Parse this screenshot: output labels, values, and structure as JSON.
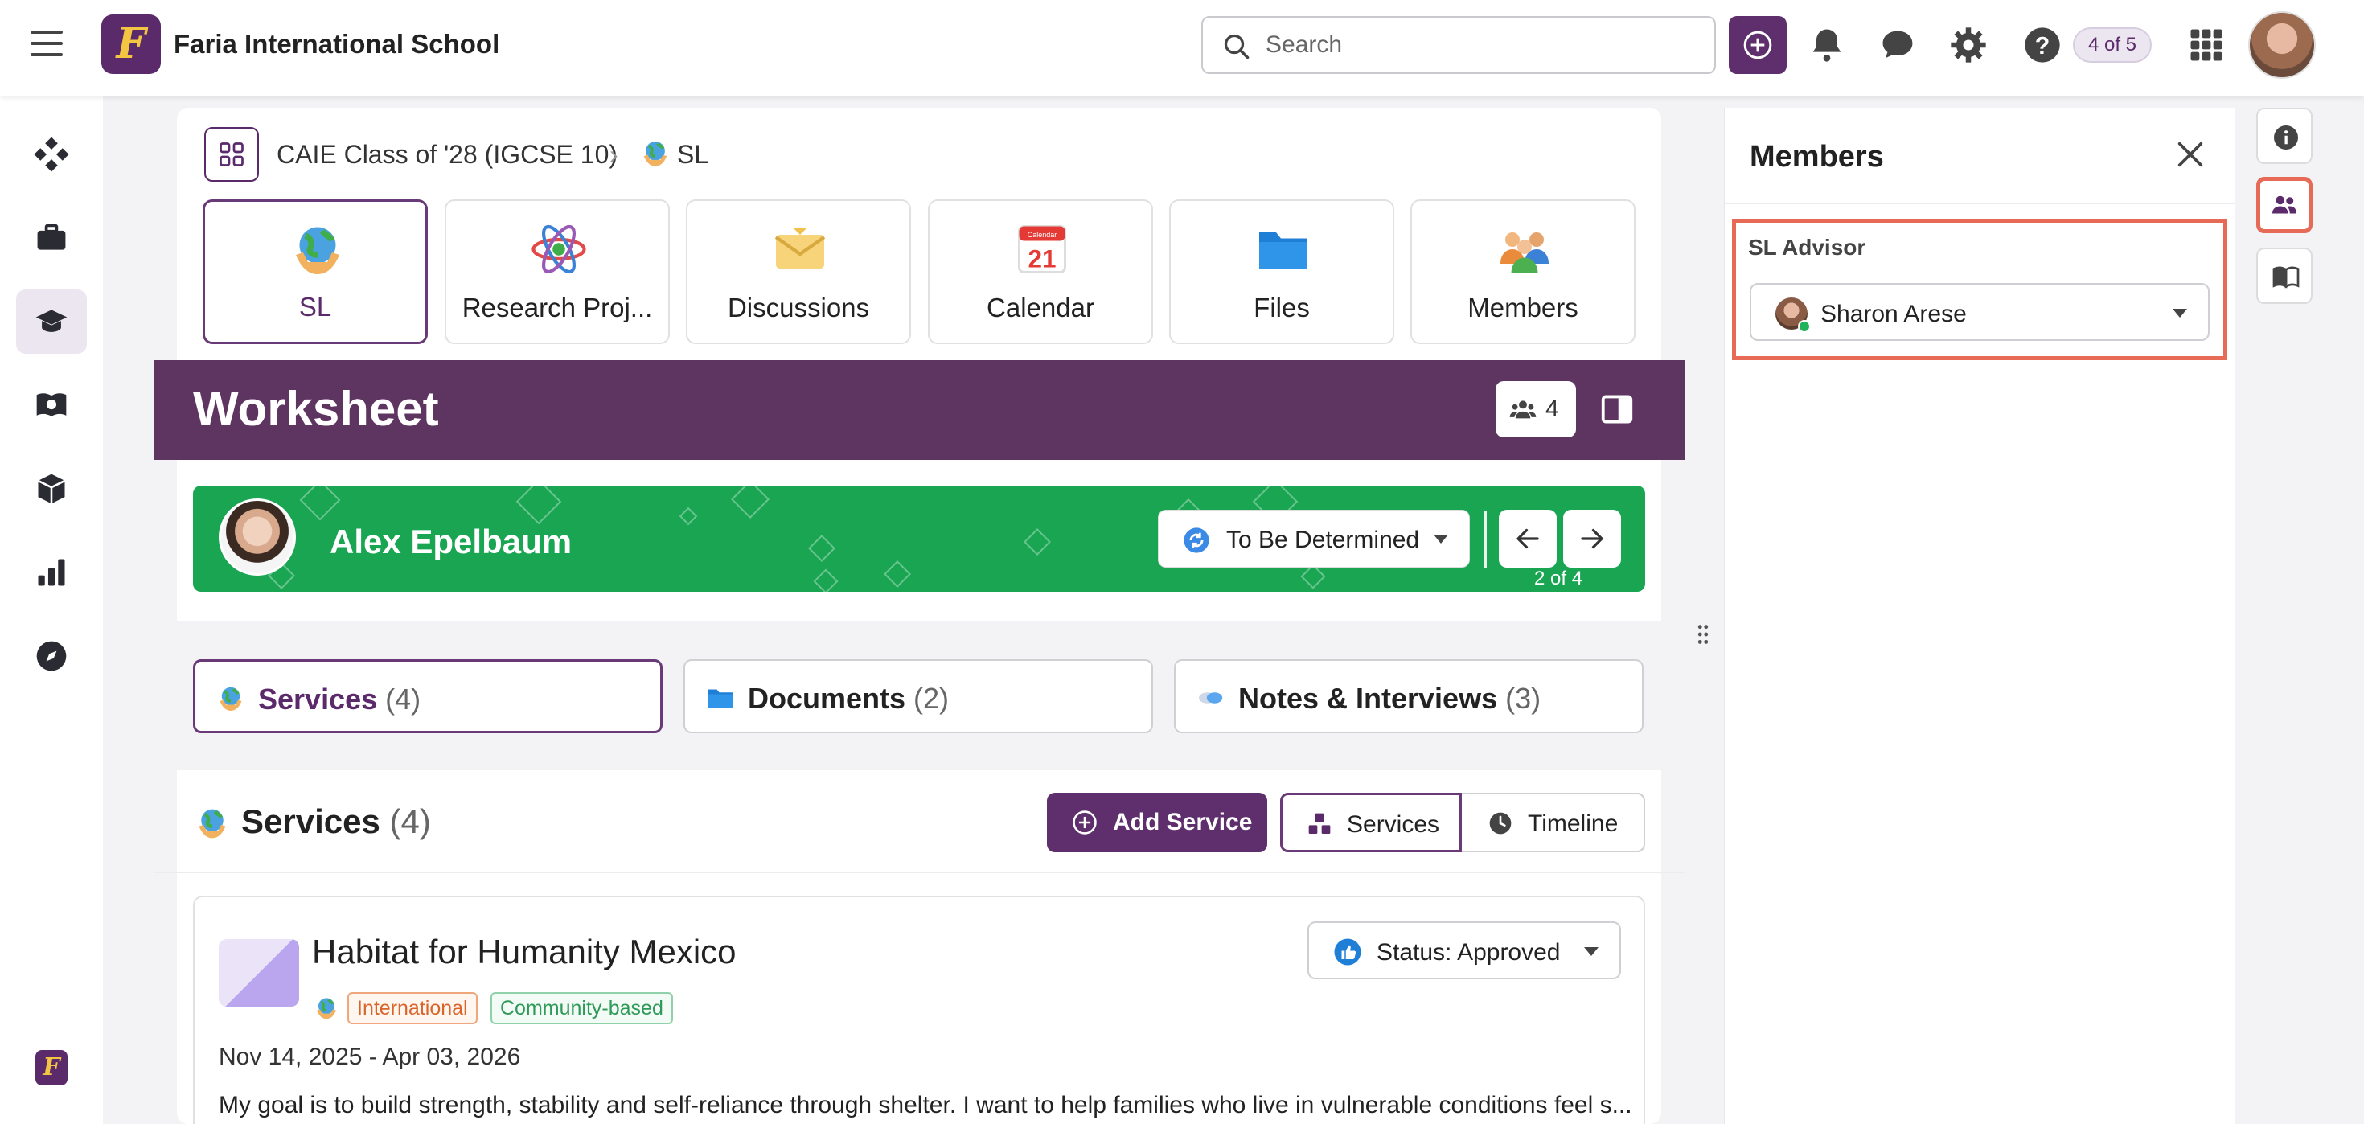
{
  "topbar": {
    "school_name": "Faria International School",
    "logo_letter": "F",
    "search_placeholder": "Search",
    "counter": "4 of 5"
  },
  "breadcrumb": {
    "class_name": "CAIE Class of '28 (IGCSE 10)",
    "separator": "›",
    "current": "SL"
  },
  "tiles": [
    {
      "label": "SL",
      "icon": "globe-hands-icon",
      "active": true
    },
    {
      "label": "Research Proj...",
      "icon": "atom-icon",
      "active": false
    },
    {
      "label": "Discussions",
      "icon": "envelope-icon",
      "active": false
    },
    {
      "label": "Calendar",
      "icon": "calendar-icon",
      "active": false,
      "calendar_day": "21",
      "calendar_month": "Calendar"
    },
    {
      "label": "Files",
      "icon": "folder-icon",
      "active": false
    },
    {
      "label": "Members",
      "icon": "people-icon",
      "active": false
    }
  ],
  "worksheet": {
    "title": "Worksheet",
    "member_count": "4"
  },
  "student": {
    "name": "Alex Epelbaum",
    "status": "To Be Determined",
    "pager": "2 of 4"
  },
  "tabs": [
    {
      "label": "Services",
      "count": "(4)",
      "icon": "globe-hands-icon",
      "active": true
    },
    {
      "label": "Documents",
      "count": "(2)",
      "icon": "folder-icon",
      "active": false
    },
    {
      "label": "Notes & Interviews",
      "count": "(3)",
      "icon": "chat-bubbles-icon",
      "active": false
    }
  ],
  "services": {
    "title": "Services",
    "count": "(4)",
    "add_label": "Add Service",
    "view_services": "Services",
    "view_timeline": "Timeline"
  },
  "service_card": {
    "name": "Habitat for Humanity Mexico",
    "status": "Status: Approved",
    "tags": [
      "International",
      "Community-based"
    ],
    "dates": "Nov 14, 2025 - Apr 03, 2026",
    "description": "My goal is to build strength, stability and self-reliance through shelter. I want to help families who live in vulnerable conditions feel s..."
  },
  "members_panel": {
    "title": "Members",
    "advisor_label": "SL Advisor",
    "advisor_name": "Sharon Arese"
  },
  "colors": {
    "brand_purple": "#5e2e6d",
    "banner_green": "#1aa552",
    "worksheet_band": "#5e3460",
    "highlight": "#e66a56"
  }
}
